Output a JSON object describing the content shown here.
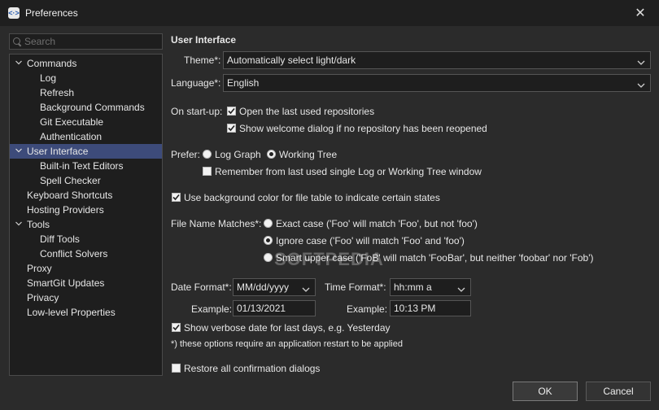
{
  "window": {
    "title": "Preferences",
    "app_icon": "<·>",
    "close_symbol": "✕"
  },
  "search": {
    "placeholder": "Search"
  },
  "tree": {
    "commands": "Commands",
    "log": "Log",
    "refresh": "Refresh",
    "background_commands": "Background Commands",
    "git_executable": "Git Executable",
    "authentication": "Authentication",
    "user_interface": "User Interface",
    "built_in_text_editors": "Built-in Text Editors",
    "spell_checker": "Spell Checker",
    "keyboard_shortcuts": "Keyboard Shortcuts",
    "hosting_providers": "Hosting Providers",
    "tools": "Tools",
    "diff_tools": "Diff Tools",
    "conflict_solvers": "Conflict Solvers",
    "proxy": "Proxy",
    "smartgit_updates": "SmartGit Updates",
    "privacy": "Privacy",
    "low_level_properties": "Low-level Properties"
  },
  "ui": {
    "section_title": "User Interface",
    "theme_label": "Theme*:",
    "theme_value": "Automatically select light/dark",
    "language_label": "Language*:",
    "language_value": "English",
    "startup_label": "On start-up:",
    "open_last_repos": "Open the last used repositories",
    "show_welcome": "Show welcome dialog if no repository has been reopened",
    "prefer_label": "Prefer:",
    "log_graph": "Log Graph",
    "working_tree": "Working Tree",
    "remember_last": "Remember from last used single Log or Working Tree window",
    "use_bg_color": "Use background color for file table to indicate certain states",
    "file_name_matches_label": "File Name Matches*:",
    "exact_case": "Exact case ('Foo' will match 'Foo', but not 'foo')",
    "ignore_case": "Ignore case ('Foo' will match 'Foo' and 'foo')",
    "smart_upper_case": "Smart upper case ('FoB' will match 'FooBar', but neither 'foobar' nor 'Fob')",
    "date_format_label": "Date Format*:",
    "date_format_value": "MM/dd/yyyy",
    "time_format_label": "Time Format*:",
    "time_format_value": "hh:mm a",
    "example_label": "Example:",
    "date_example": "01/13/2021",
    "time_example": "10:13 PM",
    "verbose_date": "Show verbose date for last days, e.g. Yesterday",
    "restart_note": "*) these options require an application restart to be applied",
    "restore_dialogs": "Restore all confirmation dialogs"
  },
  "buttons": {
    "ok": "OK",
    "cancel": "Cancel"
  },
  "watermark": "SOFTPEDIA",
  "state": {
    "open_last_repos": true,
    "show_welcome": true,
    "prefer": "working_tree",
    "remember_last": false,
    "use_bg_color": true,
    "file_name_matches": "ignore_case",
    "verbose_date": true,
    "restore_dialogs": false
  },
  "colors": {
    "background": "#2b2b2b",
    "selection": "#3d4b7a",
    "titlebar": "#1f1f1f"
  }
}
